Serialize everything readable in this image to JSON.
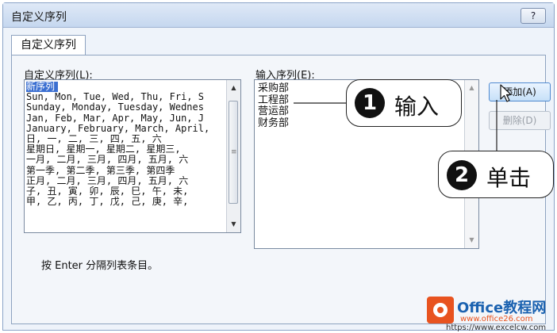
{
  "dialog": {
    "title": "自定义序列",
    "help_label": "?"
  },
  "tab": {
    "label": "自定义序列"
  },
  "custom_list": {
    "label": "自定义序列(L):",
    "items": [
      "新序列",
      "Sun, Mon, Tue, Wed, Thu, Fri, S",
      "Sunday, Monday, Tuesday, Wednes",
      "Jan, Feb, Mar, Apr, May, Jun, J",
      "January, February, March, April,",
      "日, 一, 二, 三, 四, 五, 六",
      "星期日, 星期一, 星期二, 星期三,",
      "一月, 二月, 三月, 四月, 五月, 六",
      "第一季, 第二季, 第三季, 第四季",
      "正月, 二月, 三月, 四月, 五月, 六",
      "子, 丑, 寅, 卯, 辰, 巳, 午, 未,",
      "甲, 乙, 丙, 丁, 戊, 己, 庚, 辛,"
    ],
    "selected_index": 0
  },
  "entries": {
    "label": "输入序列(E):",
    "lines": [
      "采购部",
      "工程部",
      "营运部",
      "财务部"
    ]
  },
  "buttons": {
    "add_label": "添加(A)",
    "delete_label": "删除(D)"
  },
  "hint": "按 Enter 分隔列表条目。",
  "annotations": [
    {
      "number": "1",
      "text": "输入"
    },
    {
      "number": "2",
      "text": "单击"
    }
  ],
  "watermark": {
    "brand": "Office教程网",
    "url1": "www.office26.com",
    "url2": "https://www.excelcw.com"
  },
  "colors": {
    "selection": "#3b6fd1",
    "logo_orange": "#e8531f",
    "logo_blue": "#1b62b0"
  }
}
